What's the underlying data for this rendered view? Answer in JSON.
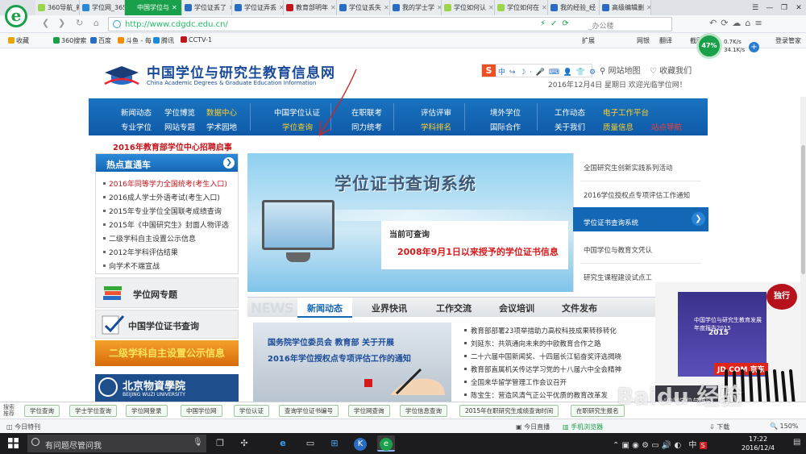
{
  "browser": {
    "tabs": [
      {
        "label": "360导航_新",
        "color": "#9bd44d"
      },
      {
        "label": "学位网_365",
        "color": "#2a88d8"
      },
      {
        "label": "中国学位与",
        "color": "#1aa04a",
        "active": true
      },
      {
        "label": "学位证丢了",
        "color": "#2a6cc4"
      },
      {
        "label": "学位证弄丢",
        "color": "#2a6cc4"
      },
      {
        "label": "教育部明年",
        "color": "#c0161b"
      },
      {
        "label": "学位证丢失",
        "color": "#2a6cc4"
      },
      {
        "label": "我的学士学",
        "color": "#2a6cc4"
      },
      {
        "label": "学位如何认",
        "color": "#9bd44d"
      },
      {
        "label": "学位如何在",
        "color": "#9bd44d"
      },
      {
        "label": "我的经验_经",
        "color": "#2a6cc4"
      },
      {
        "label": "高级编辑删",
        "color": "#2a6cc4"
      }
    ],
    "url": "http://www.cdgdc.edu.cn/",
    "search_hint": "_办公楼",
    "bookmarks": [
      "收藏",
      "360搜索",
      "百度",
      "斗鱼 - 每",
      "腾讯",
      "CCTV-1"
    ],
    "right_tools": [
      "扩展",
      "网银",
      "翻译",
      "截图",
      "登录管家"
    ],
    "speed": {
      "percent": "47%",
      "up": "0.7K/s",
      "down": "34.1K/s"
    }
  },
  "site": {
    "title": "中国学位与研究生教育信息网",
    "subtitle": "China Academic Degrees & Graduate Education Information",
    "sitemap": "网站地图",
    "favorite": "收藏我们",
    "date_line": "2016年12月4日  星期日    欢迎光临学位网！",
    "menu_row1": [
      "新闻动态",
      "学位博览",
      "数据中心",
      "中国学位认证",
      "在职联考",
      "评估评审",
      "境外学位",
      "工作动态",
      "电子工作平台"
    ],
    "menu_row2": [
      "专业学位",
      "网站专题",
      "学术园地",
      "学位查询",
      "同力统考",
      "学科排名",
      "国际合作",
      "关于我们",
      "质量信息",
      "站点导航"
    ],
    "recruit": "2016年教育部学位中心招聘启事",
    "hot_title": "热点直通车",
    "hot_items": [
      "2016年同等学力全国统考(考生入口)",
      "2016成人学士外语考试(考生入口)",
      "2015年专业学位全国联考成绩查询",
      "2015年《中国研究生》封面人物评选",
      "二级学科自主设置公示信息",
      "2012年学科评估结果",
      "向学术不端宣战"
    ],
    "card_special": "学位网专题",
    "card_cert": "中国学位证书查询",
    "banner_gold": "二级学科自主设置公示信息",
    "bj_title": "北京物資學院",
    "bj_sub": "BEIJING WUZI UNIVERSITY",
    "hero_title": "学位证书查询系统",
    "hero_now": "当前可查询",
    "hero_since": "2008年9月1日以来授予的学位证书信息",
    "right_links": [
      "全国研究生创新实践系列活动",
      "2016学位授权点专项评估工作通知",
      "学位证书查询系统",
      "中国学位与教育文凭认",
      "研究生课程建设试点工"
    ],
    "news_word": "NEWS",
    "news_tabs": [
      "新闻动态",
      "业界快讯",
      "工作交流",
      "会议培训",
      "文件发布"
    ],
    "news_img_l1": "国务院学位委员会 教育部 关于开展",
    "news_img_l2": "2016年学位授权点专项评估工作的通知",
    "news_list": [
      "教育部部署23项举措助力高校科技成果转移转化",
      "刘延东：共筑通向未来的中欧教育合作之路",
      "二十六届中国新闻奖、十四届长江韬奋奖评选揭晓",
      "教育部直属机关传达学习党的十八届六中全会精神",
      "全国来华留学管理工作会议召开",
      "陈宝生：营造风清气正公平优质的教育改革发"
    ]
  },
  "ad": {
    "book_title": "中国学位与研究生教育发展年度报告2015",
    "book_year": "2015",
    "stamp": "独行",
    "jd": "JD.COM 京东",
    "book2": "《中国学位与研究",
    "watermark": "Baidu 经验"
  },
  "tagbar": {
    "label1": "搜索",
    "label2": "推荐",
    "tags": [
      "学位查询",
      "学士学位查询",
      "学位网登录",
      "中国学位网",
      "学位认证",
      "查询学位证书编号",
      "学位网查询",
      "学位信息查询",
      "2015年在职研究生成绩查询时间",
      "在职研究生报名"
    ]
  },
  "status": {
    "today": "今日特刊",
    "headline": "今日直播",
    "mobile": "手机浏览器",
    "download": "下载",
    "zoom": "150%"
  },
  "taskbar": {
    "search": "有问题尽管问我",
    "ime": "中",
    "time": "17:22",
    "date": "2016/12/4"
  }
}
